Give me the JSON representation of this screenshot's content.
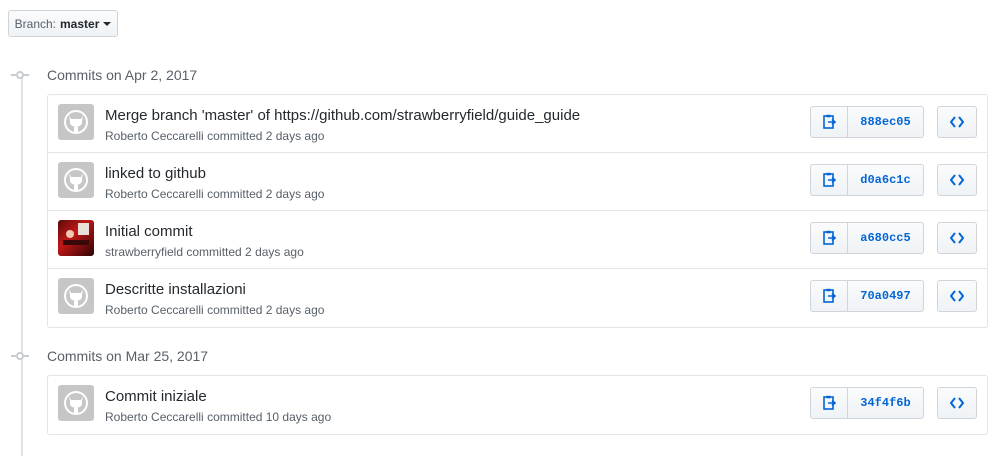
{
  "branch": {
    "label": "Branch:",
    "value": "master"
  },
  "groups": [
    {
      "title": "Commits on Apr 2, 2017",
      "commits": [
        {
          "message": "Merge branch 'master' of https://github.com/strawberryfield/guide_guide",
          "author": "Roberto Ceccarelli",
          "time": "committed 2 days ago",
          "sha": "888ec05",
          "avatar": "default"
        },
        {
          "message": "linked to github",
          "author": "Roberto Ceccarelli",
          "time": "committed 2 days ago",
          "sha": "d0a6c1c",
          "avatar": "default"
        },
        {
          "message": "Initial commit",
          "author": "strawberryfield",
          "time": "committed 2 days ago",
          "sha": "a680cc5",
          "avatar": "photo"
        },
        {
          "message": "Descritte installazioni",
          "author": "Roberto Ceccarelli",
          "time": "committed 2 days ago",
          "sha": "70a0497",
          "avatar": "default"
        }
      ]
    },
    {
      "title": "Commits on Mar 25, 2017",
      "commits": [
        {
          "message": "Commit iniziale",
          "author": "Roberto Ceccarelli",
          "time": "committed 10 days ago",
          "sha": "34f4f6b",
          "avatar": "default"
        }
      ]
    }
  ],
  "colors": {
    "link": "#0366d6",
    "muted": "#586069",
    "border": "#e1e4e8"
  },
  "icons": {
    "copy": "clipboard-icon",
    "browse": "code-brackets-icon",
    "avatar": "octocat-icon"
  }
}
